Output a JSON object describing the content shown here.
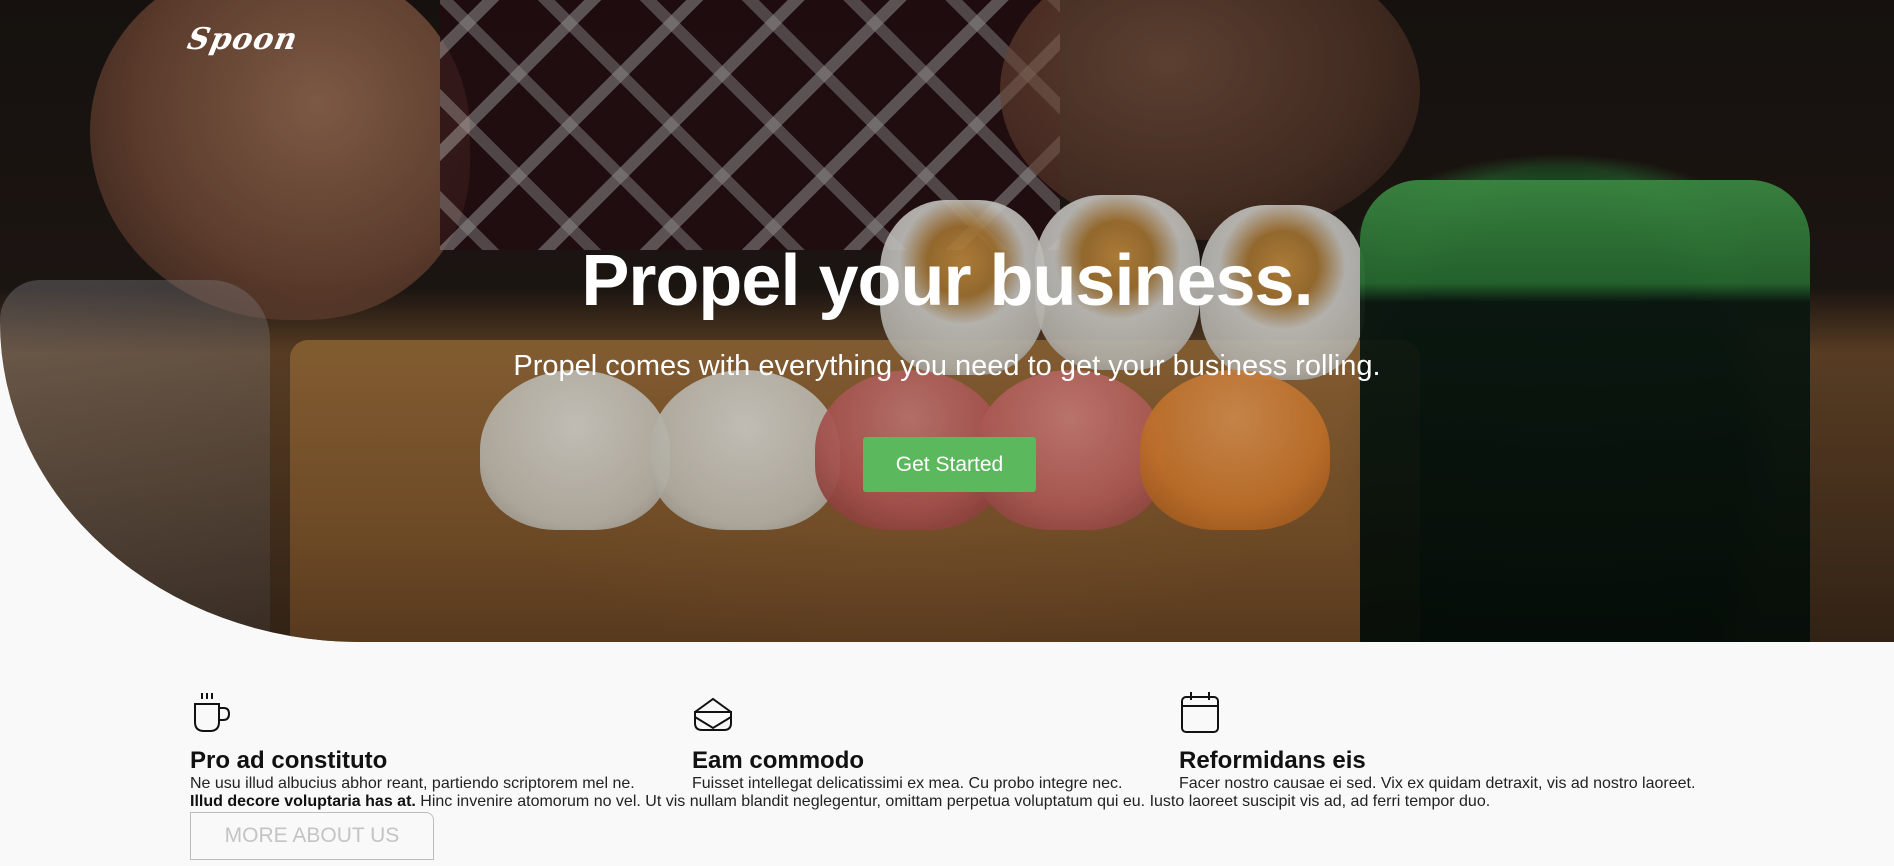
{
  "brand": {
    "logo_text": "Spoon"
  },
  "hero": {
    "title": "Propel your business.",
    "subtitle": "Propel comes with everything you need to get your business rolling.",
    "cta_label": "Get Started",
    "cta_color": "#5cb85c"
  },
  "features": [
    {
      "icon": "coffee-cup-icon",
      "title": "Pro ad constituto",
      "text": "Ne usu illud albucius abhor reant, partiendo scriptorem mel ne."
    },
    {
      "icon": "sandwich-icon",
      "title": "Eam commodo",
      "text": "Fuisset intellegat delicatissimi ex mea. Cu probo integre nec."
    },
    {
      "icon": "calendar-icon",
      "title": "Reformidans eis",
      "text": "Facer nostro causae ei sed. Vix ex quidam detraxit, vis ad nostro laoreet."
    }
  ],
  "about": {
    "lead_bold": "Illud decore voluptaria has at.",
    "body": " Hinc invenire atomorum no vel. Ut vis nullam blandit neglegentur, omittam perpetua voluptatum qui eu. Iusto laoreet suscipit vis ad, ad ferri tempor duo.",
    "button_label": "MORE ABOUT US"
  }
}
